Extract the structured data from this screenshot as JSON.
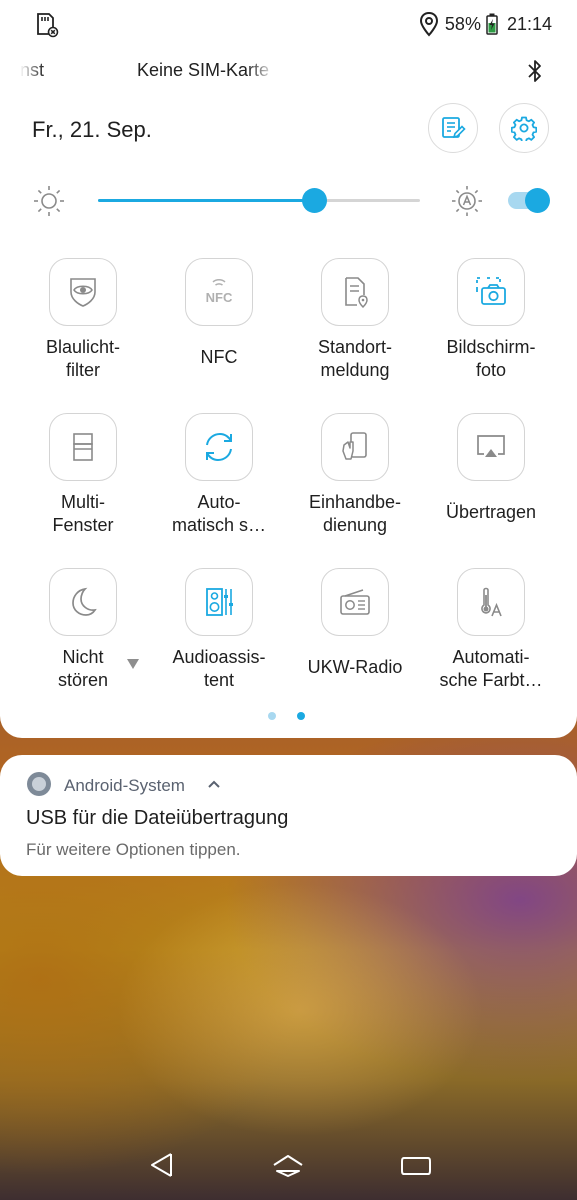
{
  "status_bar": {
    "battery_percent": "58%",
    "time": "21:14",
    "icons": [
      "sd-card-icon",
      "location-icon",
      "battery-charging-icon"
    ]
  },
  "carrier": {
    "left_fragment": "nst",
    "center_text": "Keine SIM-Karte",
    "icon": "bluetooth-icon"
  },
  "header": {
    "date": "Fr., 21. Sep.",
    "edit_icon": "edit-tiles-icon",
    "settings_icon": "gear-icon"
  },
  "brightness": {
    "level": 0.67,
    "auto_enabled": true,
    "accent": "#1ba9e1"
  },
  "tiles": [
    {
      "label": "Blaulicht-\nfilter",
      "icon": "eye-shield-icon",
      "active": false
    },
    {
      "label": "NFC",
      "icon": "nfc-icon",
      "active": false
    },
    {
      "label": "Standort-\nmeldung",
      "icon": "location-report-icon",
      "active": false
    },
    {
      "label": "Bildschirm-\nfoto",
      "icon": "screenshot-icon",
      "active": true
    },
    {
      "label": "Multi-\nFenster",
      "icon": "multi-window-icon",
      "active": false
    },
    {
      "label": "Auto-\nmatisch s…",
      "icon": "auto-rotate-icon",
      "active": true
    },
    {
      "label": "Einhandbe-\ndienung",
      "icon": "one-hand-icon",
      "active": false
    },
    {
      "label": "Übertragen",
      "icon": "cast-icon",
      "active": false
    },
    {
      "label": "Nicht\nstören",
      "icon": "moon-icon",
      "active": false
    },
    {
      "label": "Audioassis-\ntent",
      "icon": "audio-wizard-icon",
      "active": true
    },
    {
      "label": "UKW-Radio",
      "icon": "radio-icon",
      "active": false
    },
    {
      "label": "Automati-\nsche Farbt…",
      "icon": "color-temperature-icon",
      "active": false
    }
  ],
  "pages": {
    "count": 2,
    "current": 2
  },
  "notification": {
    "app_name": "Android-System",
    "title": "USB für die Dateiübertragung",
    "text": "Für weitere Optionen tippen."
  },
  "nav_bar": {
    "icons": [
      "back-icon",
      "home-icon",
      "recents-icon"
    ]
  }
}
